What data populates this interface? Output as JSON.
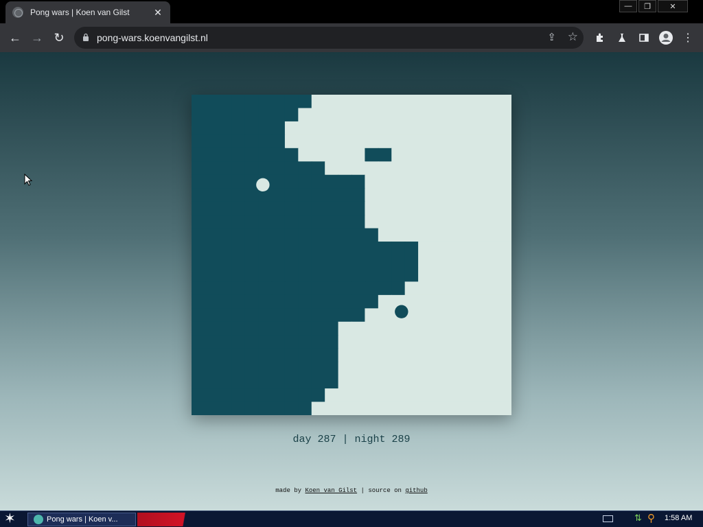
{
  "browser": {
    "tab": {
      "title": "Pong wars | Koen van Gilst",
      "close_glyph": "✕"
    },
    "window_controls": {
      "minimize": "—",
      "restore": "❐",
      "close": "✕"
    },
    "nav": {
      "back": "←",
      "forward": "→",
      "reload": "↻"
    },
    "address_bar": {
      "url": "pong-wars.koenvangilst.nl"
    },
    "icons": [
      "share-icon",
      "star-icon",
      "extensions-icon",
      "labs-icon",
      "side-panel-icon",
      "profile-icon",
      "menu-icon"
    ]
  },
  "game": {
    "colors": {
      "day": "#d9e8e3",
      "night": "#114c5a"
    },
    "grid": {
      "cols": 24,
      "rows": 24
    },
    "night_cells_per_row": [
      9,
      8,
      7,
      7,
      8,
      11,
      13,
      13,
      13,
      13,
      14,
      17,
      17,
      17,
      16,
      14,
      13,
      11,
      11,
      11,
      11,
      11,
      10,
      9
    ],
    "day_cells_in_night": [
      [
        10,
        5
      ],
      [
        11,
        5
      ]
    ],
    "night_cells_in_day": [
      [
        13,
        4
      ],
      [
        14,
        4
      ]
    ],
    "balls": [
      {
        "team": "day",
        "col": 5.35,
        "row": 6.75
      },
      {
        "team": "night",
        "col": 15.75,
        "row": 16.25
      }
    ]
  },
  "score_text": "day 287 | night 289",
  "credits": {
    "made_by": "made by",
    "author": "Koen van Gilst",
    "separator": "|",
    "source_on": "source on",
    "github": "github"
  },
  "taskbar": {
    "task_label": "Pong wars | Koen v...",
    "clock": "1:58 AM"
  }
}
